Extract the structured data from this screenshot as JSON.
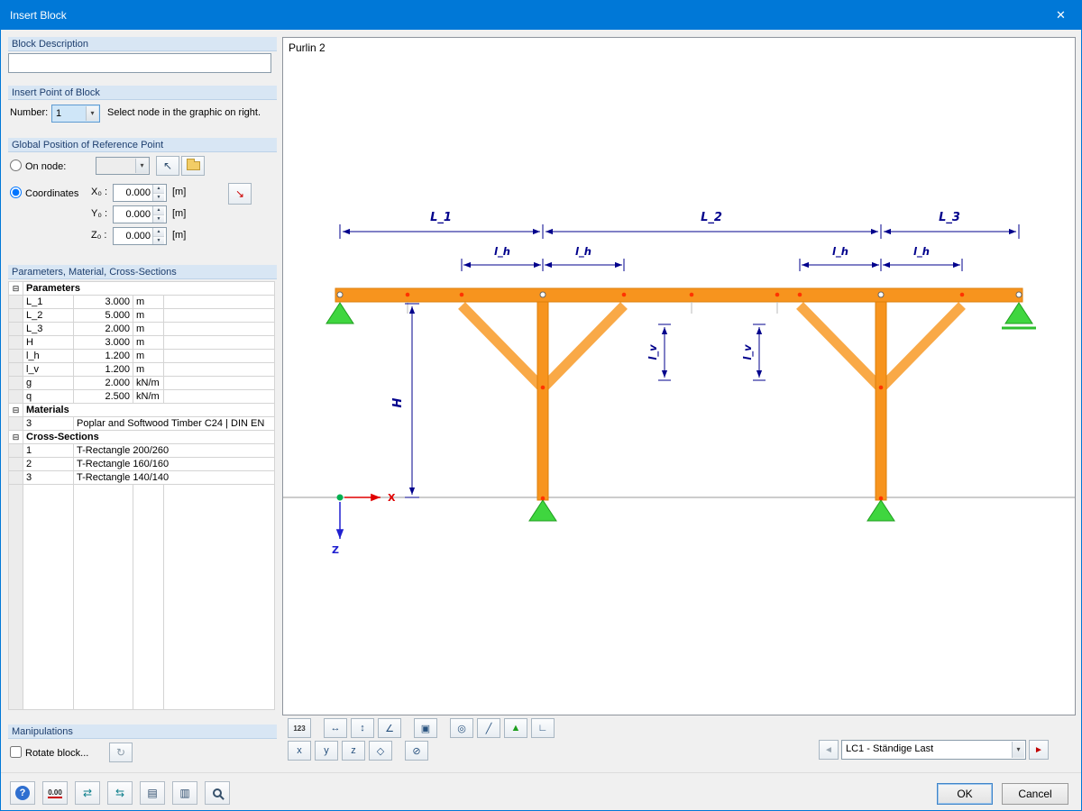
{
  "titlebar": {
    "title": "Insert Block"
  },
  "icons": {
    "close": "✕",
    "dropdown": "▾",
    "spin_up": "▲",
    "spin_down": "▼",
    "pick_node": "↖",
    "pick_coords": "↘",
    "collapse": "⊟",
    "rotate": "↻",
    "numbering": "123",
    "dim_horizontal": "↔",
    "dim_vertical": "↕",
    "dim_angle": "∠",
    "render": "▣",
    "visibility": "◎",
    "section": "╱",
    "support": "▲",
    "axes": "∟",
    "view_x": "x",
    "view_y": "y",
    "view_z": "z",
    "isometric": "◇",
    "zoom_off": "⊘",
    "help": "?",
    "decimals": "0.00",
    "export": "⇄",
    "import": "⇆",
    "copy": "▤",
    "paste": "▥",
    "prev": "◄",
    "next": "►"
  },
  "left": {
    "block_description": {
      "header": "Block Description"
    },
    "insert_point": {
      "header": "Insert Point of Block",
      "number_label": "Number:",
      "number_value": "1",
      "hint": "Select node in the graphic on right."
    },
    "global_position": {
      "header": "Global Position of Reference Point",
      "on_node_label": "On node:",
      "coordinates_label": "Coordinates",
      "coords": [
        {
          "label": "X₀ :",
          "value": "0.000",
          "unit": "[m]"
        },
        {
          "label": "Y₀ :",
          "value": "0.000",
          "unit": "[m]"
        },
        {
          "label": "Z₀ :",
          "value": "0.000",
          "unit": "[m]"
        }
      ]
    },
    "table": {
      "header": "Parameters, Material, Cross-Sections",
      "groups": {
        "parameters": "Parameters",
        "materials": "Materials",
        "sections": "Cross-Sections"
      },
      "param_rows": [
        {
          "key": "L_1",
          "value": "3.000",
          "unit": "m"
        },
        {
          "key": "L_2",
          "value": "5.000",
          "unit": "m"
        },
        {
          "key": "L_3",
          "value": "2.000",
          "unit": "m"
        },
        {
          "key": "H",
          "value": "3.000",
          "unit": "m"
        },
        {
          "key": "l_h",
          "value": "1.200",
          "unit": "m"
        },
        {
          "key": "l_v",
          "value": "1.200",
          "unit": "m"
        },
        {
          "key": "g",
          "value": "2.000",
          "unit": "kN/m"
        },
        {
          "key": "q",
          "value": "2.500",
          "unit": "kN/m"
        }
      ],
      "material_rows": [
        {
          "key": "3",
          "value": "Poplar and Softwood Timber C24 | DIN EN"
        }
      ],
      "section_rows": [
        {
          "key": "1",
          "value": "T-Rectangle 200/260"
        },
        {
          "key": "2",
          "value": "T-Rectangle 160/160"
        },
        {
          "key": "3",
          "value": "T-Rectangle 140/140"
        }
      ]
    },
    "manipulations": {
      "header": "Manipulations",
      "rotate_label": "Rotate block..."
    }
  },
  "graphic": {
    "caption": "Purlin 2",
    "labels": {
      "L1": "L_1",
      "L2": "L_2",
      "L3": "L_3",
      "lh": "l_h",
      "lv": "l_v",
      "H": "H",
      "axis_x": "X",
      "axis_z": "Z"
    },
    "colors": {
      "member": "#f7941e",
      "brace": "#f9a947",
      "support": "#3fd63f",
      "dimension": "#00008c"
    }
  },
  "loadcase": {
    "value": "LC1 - Ständige Last"
  },
  "footer": {
    "ok": "OK",
    "cancel": "Cancel"
  }
}
